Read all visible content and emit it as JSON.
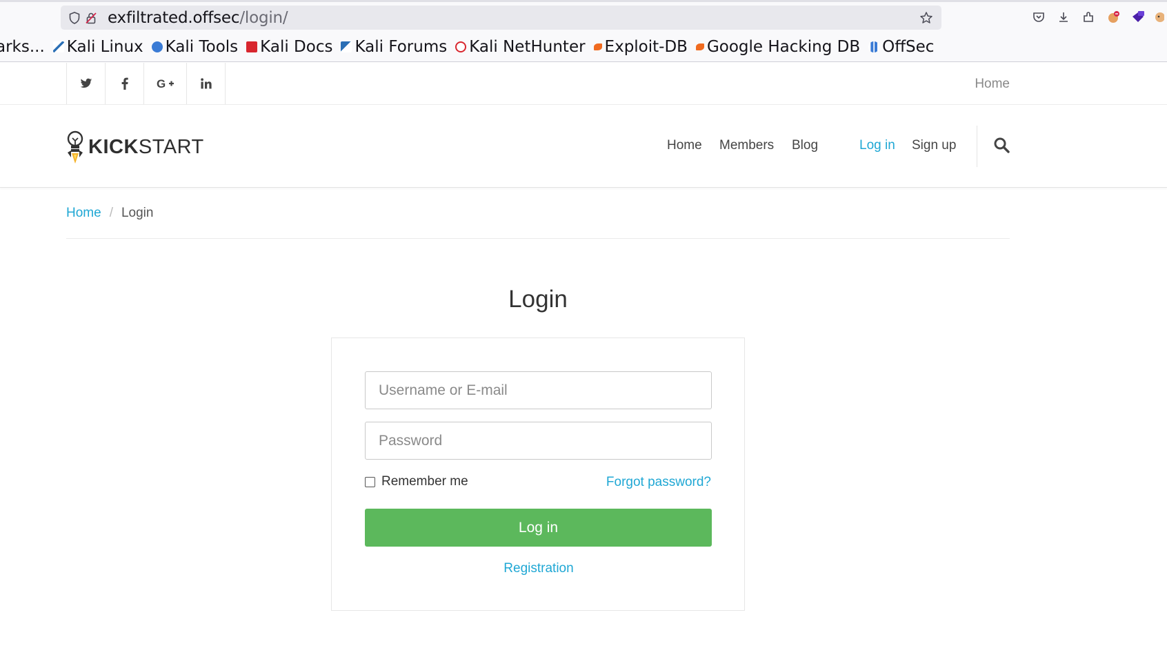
{
  "browser": {
    "url_host": "exfiltrated.offsec",
    "url_path": "/login/",
    "bookmarks": [
      {
        "label": "arks...",
        "color": "#8a8a8a"
      },
      {
        "label": "Kali Linux",
        "color": "#2b6fb5"
      },
      {
        "label": "Kali Tools",
        "color": "#3a7bd5"
      },
      {
        "label": "Kali Docs",
        "color": "#d8262e"
      },
      {
        "label": "Kali Forums",
        "color": "#2b6fb5"
      },
      {
        "label": "Kali NetHunter",
        "color": "#d8262e"
      },
      {
        "label": "Exploit-DB",
        "color": "#f06b20"
      },
      {
        "label": "Google Hacking DB",
        "color": "#f06b20"
      },
      {
        "label": "OffSec",
        "color": "#3a7bd5"
      }
    ]
  },
  "topbar": {
    "social": [
      "twitter-icon",
      "facebook-icon",
      "google-plus-icon",
      "linkedin-icon"
    ],
    "home_label": "Home"
  },
  "navbar": {
    "logo_bold": "KICK",
    "logo_light": "START",
    "links": {
      "home": "Home",
      "members": "Members",
      "blog": "Blog",
      "login": "Log in",
      "signup": "Sign up"
    }
  },
  "breadcrumb": {
    "home": "Home",
    "separator": "/",
    "current": "Login"
  },
  "login": {
    "title": "Login",
    "username_placeholder": "Username or E-mail",
    "password_placeholder": "Password",
    "remember_label": "Remember me",
    "forgot_label": "Forgot password?",
    "submit_label": "Log in",
    "register_label": "Registration"
  },
  "colors": {
    "accent": "#1fa7d4",
    "button": "#5cb85c"
  }
}
